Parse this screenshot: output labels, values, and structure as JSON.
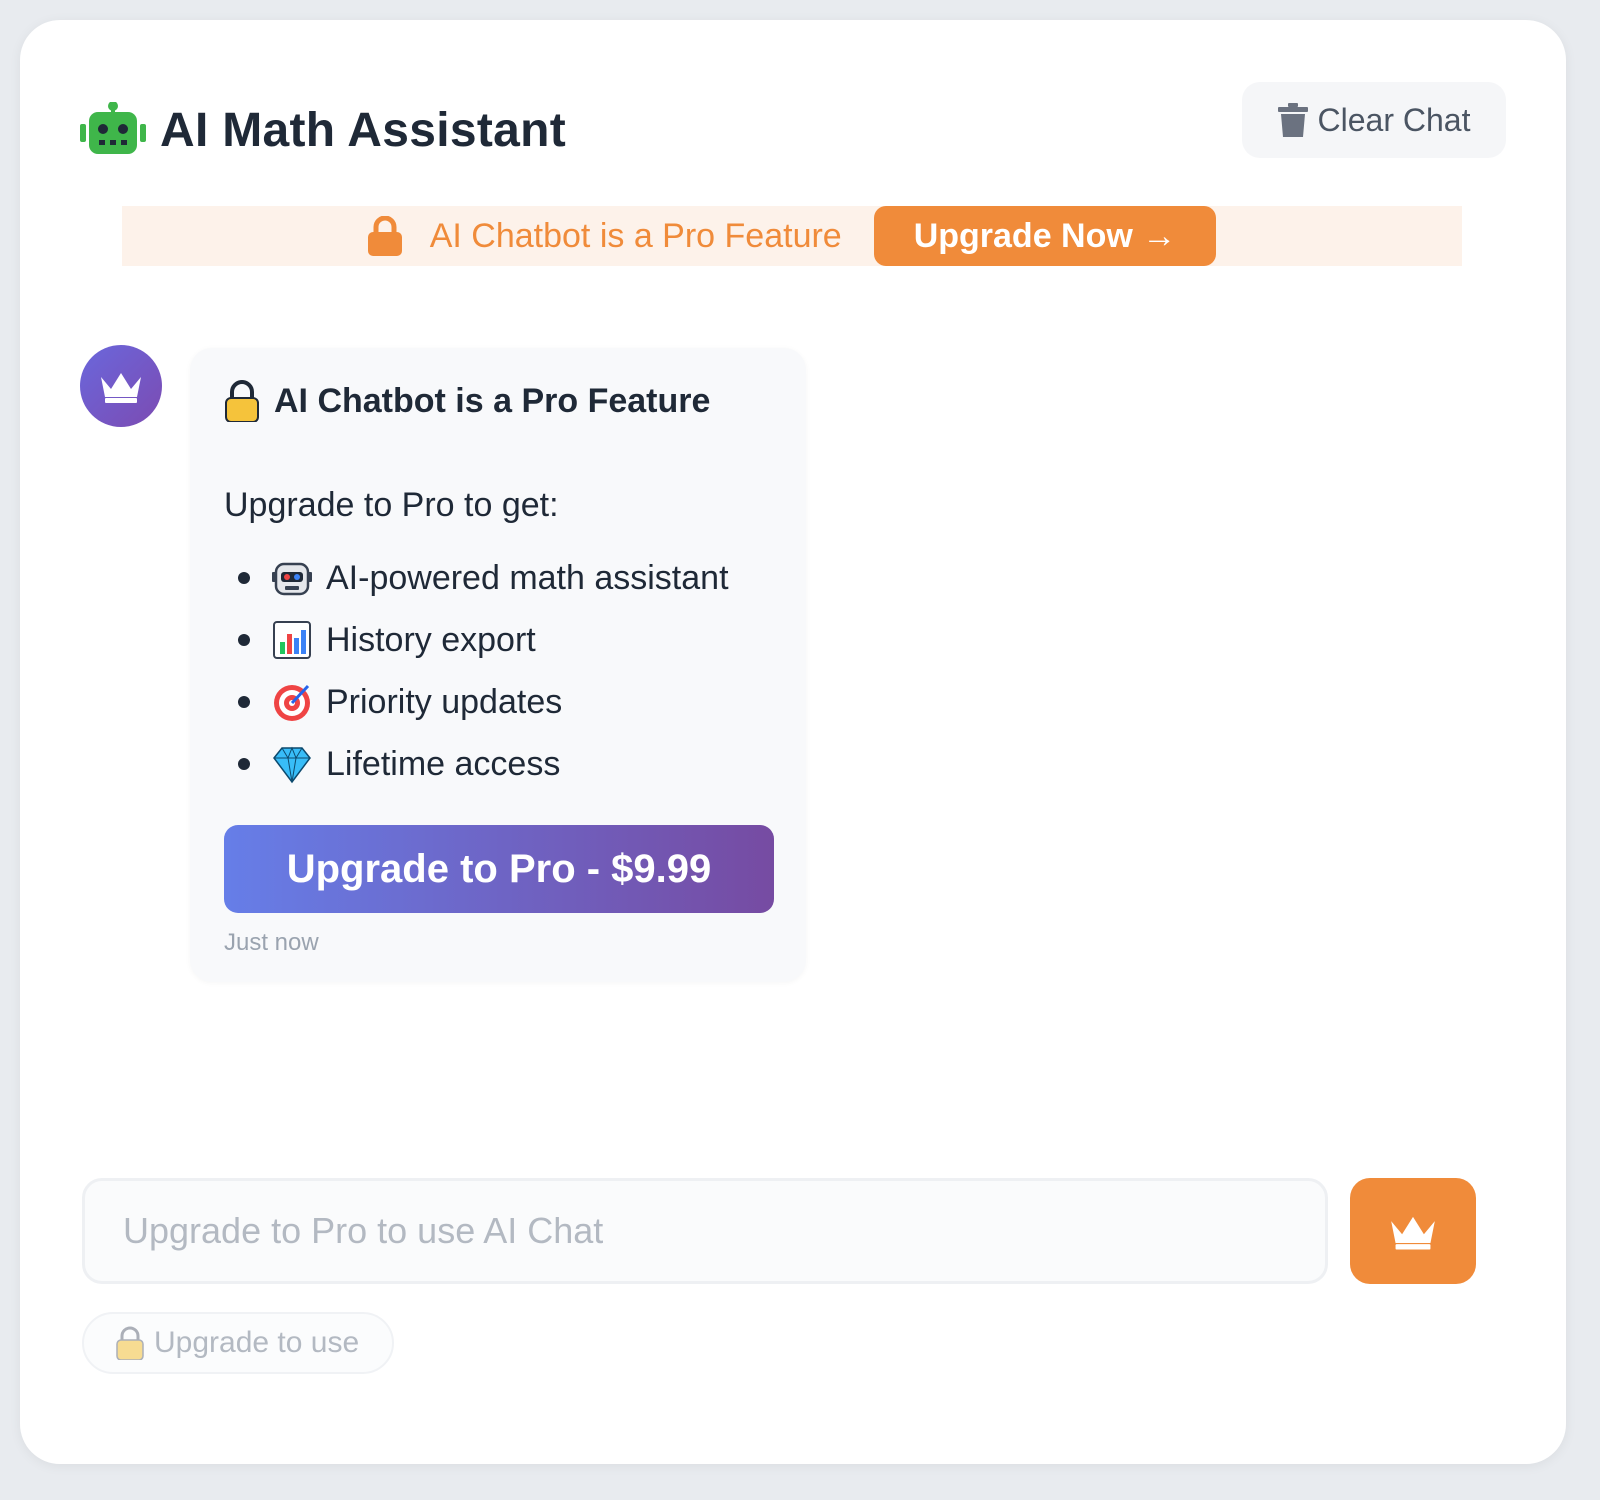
{
  "header": {
    "title": "AI Math Assistant",
    "icon": "robot-icon",
    "clear_label": "Clear Chat"
  },
  "banner": {
    "text": "AI Chatbot is a Pro Feature",
    "button_label": "Upgrade Now →",
    "accent_color": "#f08b3a"
  },
  "message": {
    "title": "AI Chatbot is a Pro Feature",
    "intro": "Upgrade to Pro to get:",
    "features": [
      {
        "icon": "robot-face-icon",
        "label": "AI-powered math assistant"
      },
      {
        "icon": "bar-chart-icon",
        "label": "History export"
      },
      {
        "icon": "target-icon",
        "label": "Priority updates"
      },
      {
        "icon": "gem-icon",
        "label": "Lifetime access"
      }
    ],
    "cta_label": "Upgrade to Pro - $9.99",
    "timestamp": "Just now"
  },
  "input": {
    "placeholder": "Upgrade to Pro to use AI Chat"
  },
  "hint": {
    "label": "Upgrade to use"
  },
  "colors": {
    "brand_purple_start": "#667ee8",
    "brand_purple_end": "#764ba2",
    "orange": "#f08b3a"
  }
}
